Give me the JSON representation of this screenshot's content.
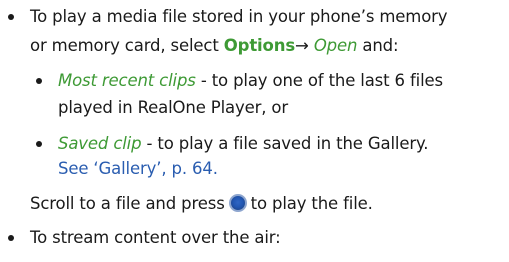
{
  "lines": {
    "l1": "To play a media file stored in your phone’s memory",
    "l2_pre": "or memory card, select ",
    "options": "Options",
    "arrow": "→",
    "open": "Open",
    "l2_post": " and:",
    "most_recent": "Most recent clips",
    "most_recent_desc": " - to play one of the last 6 files",
    "most_recent_desc2": "played in RealOne Player, or",
    "saved_clip": "Saved clip",
    "saved_clip_desc": " - to play a file saved in the Gallery.",
    "see_ref": "See ‘Gallery’, p. 64.",
    "scroll_pre": "Scroll to a file and press",
    "scroll_post": "to play the file.",
    "stream": "To stream content over the air:"
  },
  "icons": {
    "select_key": "navi-key-press-icon"
  },
  "colors": {
    "accent_green": "#3e9a35",
    "link_blue": "#2a5db0"
  }
}
